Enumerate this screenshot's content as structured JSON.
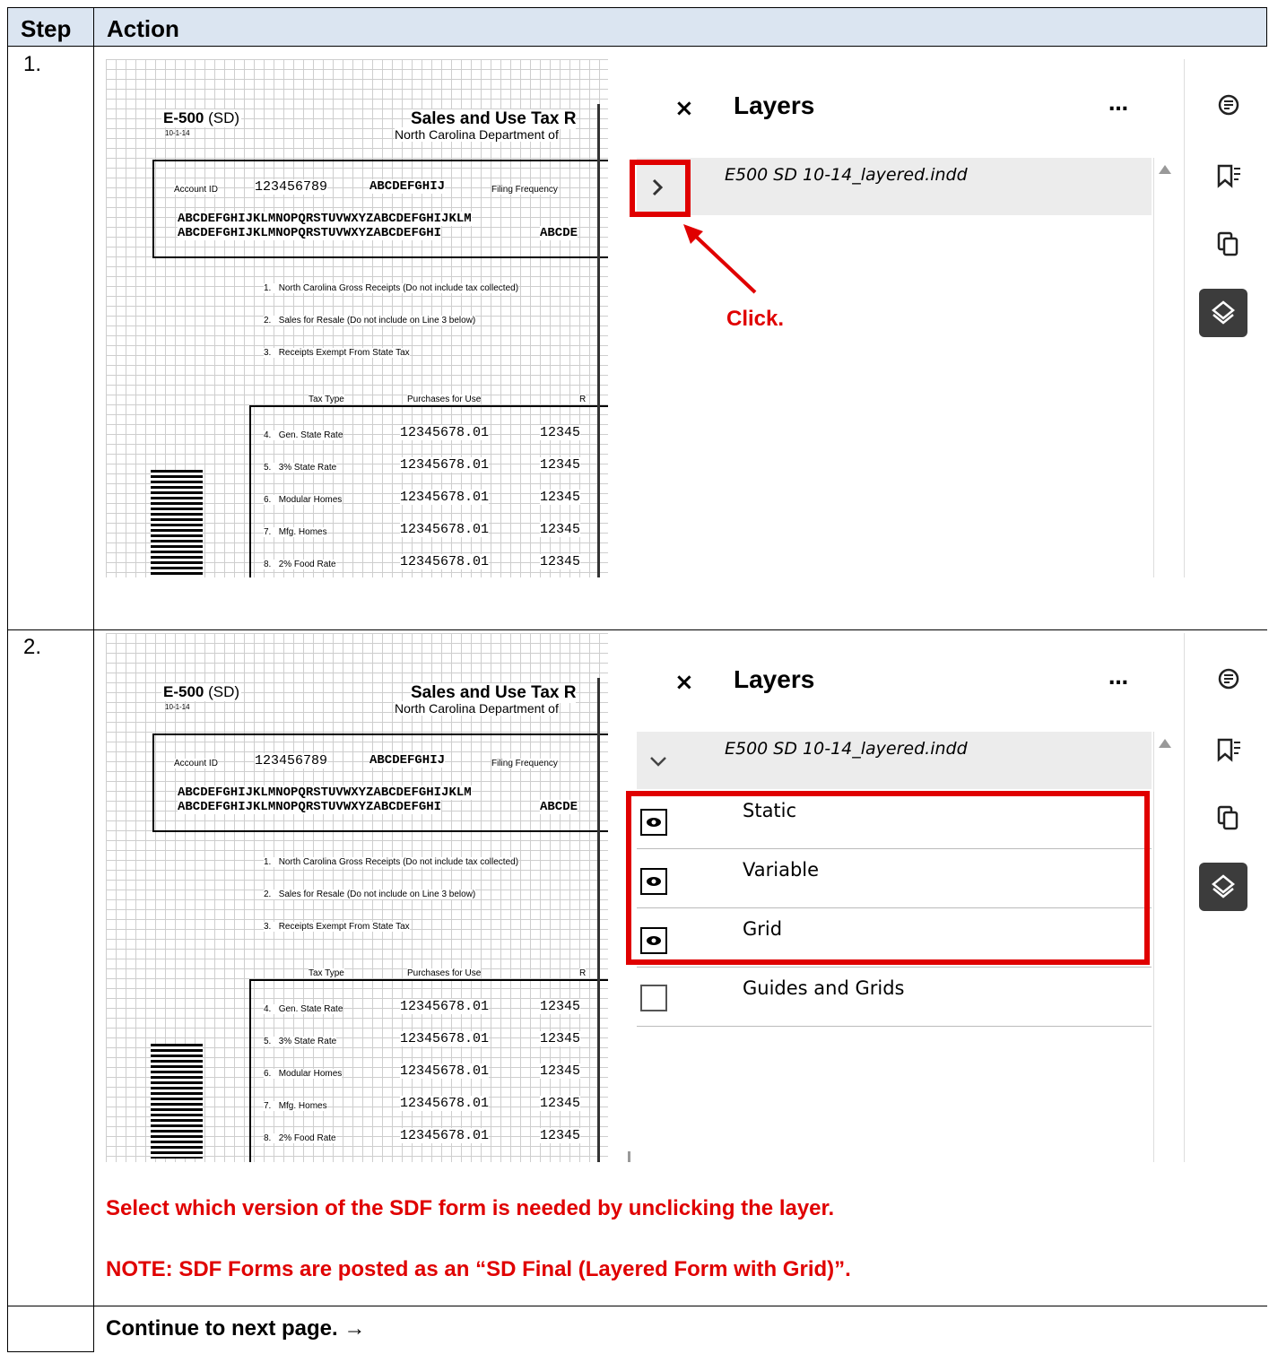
{
  "header": {
    "col_step": "Step",
    "col_action": "Action"
  },
  "steps": [
    {
      "number": "1.",
      "callout": "Click."
    },
    {
      "number": "2.",
      "instruction": "Select which version of the SDF form is needed by unclicking the layer.",
      "note": "NOTE: SDF Forms are posted as an “SD Final (Layered Form with Grid)”."
    }
  ],
  "footer": {
    "text": "Continue to next page. →"
  },
  "document": {
    "form_id": "E-500",
    "form_variant": "(SD)",
    "form_date": "10-1-14",
    "title": "Sales and Use Tax R",
    "subtitle": "North Carolina Department of",
    "account_label": "Account ID",
    "account_id": "123456789",
    "account_name": "ABCDEFGHIJ",
    "filing_label": "Filing Frequency",
    "address_line1": "ABCDEFGHIJKLMNOPQRSTUVWXYZABCDEFGHIJKLM",
    "address_line2": "ABCDEFGHIJKLMNOPQRSTUVWXYZABCDEFGHI",
    "address_line2b": "ABCDE",
    "line1": "North Carolina Gross Receipts (Do not include tax collected)",
    "line2": "Sales for Resale (Do not include on Line 3 below)",
    "line3": "Receipts Exempt From State Tax",
    "col_tax_type": "Tax Type",
    "col_purchases": "Purchases for Use",
    "col_r": "R",
    "rows": [
      {
        "num": "4.",
        "label": "Gen. State Rate",
        "amount": "12345678.01",
        "amount2": "12345"
      },
      {
        "num": "5.",
        "label": "3% State Rate",
        "amount": "12345678.01",
        "amount2": "12345"
      },
      {
        "num": "6.",
        "label": "Modular Homes",
        "amount": "12345678.01",
        "amount2": "12345"
      },
      {
        "num": "7.",
        "label": "Mfg. Homes",
        "amount": "12345678.01",
        "amount2": "12345"
      },
      {
        "num": "8.",
        "label": "2% Food Rate",
        "amount": "12345678.01",
        "amount2": "12345"
      }
    ],
    "numbered_lines": [
      "1.",
      "2.",
      "3."
    ]
  },
  "layers_panel": {
    "title": "Layers",
    "close": "×",
    "more": "…",
    "file_name": "E500 SD 10-14_layered.indd",
    "layers": [
      {
        "name": "Static",
        "visible": true
      },
      {
        "name": "Variable",
        "visible": true
      },
      {
        "name": "Grid",
        "visible": true
      },
      {
        "name": "Guides and Grids",
        "visible": false
      }
    ]
  },
  "colors": {
    "header_bg": "#dbe5f1",
    "highlight": "#e00000",
    "active_tool": "#3c3c3c"
  }
}
